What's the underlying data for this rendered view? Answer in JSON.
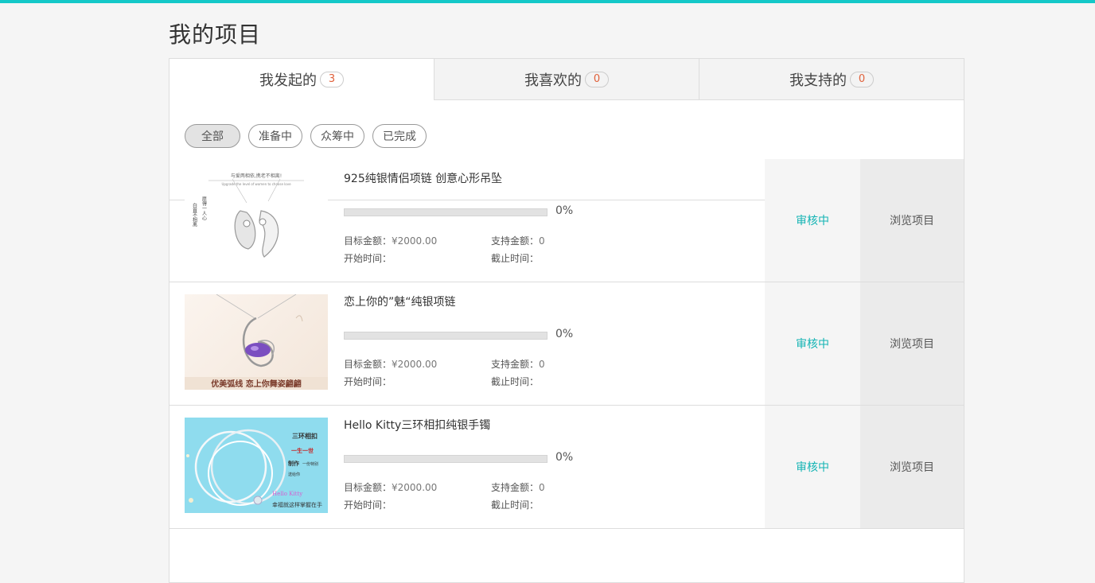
{
  "page_title": "我的项目",
  "tabs": [
    {
      "label": "我发起的",
      "count": "3"
    },
    {
      "label": "我喜欢的",
      "count": "0"
    },
    {
      "label": "我支持的",
      "count": "0"
    }
  ],
  "filters": [
    "全部",
    "准备中",
    "众筹中",
    "已完成"
  ],
  "labels": {
    "goal": "目标金额：",
    "support": "支持金额：",
    "start": "开始时间：",
    "end": "截止时间："
  },
  "projects": [
    {
      "title": "925纯银情侣项链 创意心形吊坠",
      "progress": 0,
      "progress_text": "0%",
      "goal": "¥2000.00",
      "support": "0",
      "start": "",
      "end": "",
      "status": "审核中",
      "action": "浏览项目"
    },
    {
      "title": "恋上你的”魅“纯银项链",
      "progress": 0,
      "progress_text": "0%",
      "goal": "¥2000.00",
      "support": "0",
      "start": "",
      "end": "",
      "status": "审核中",
      "action": "浏览项目"
    },
    {
      "title": "Hello Kitty三环相扣纯银手镯",
      "progress": 0,
      "progress_text": "0%",
      "goal": "¥2000.00",
      "support": "0",
      "start": "",
      "end": "",
      "status": "审核中",
      "action": "浏览项目"
    }
  ],
  "images": {
    "img1_text_top": "与爱两相依,携老不相离!",
    "img1_text_sub": "Upgrade the level of women to choose love",
    "img1_text_left1": "白首不相离",
    "img1_text_left2": "愿得一人心",
    "img2_caption": "优美弧线 恋上你舞姿翩翩",
    "img3_text1": "三环相扣",
    "img3_text2": "一生一世",
    "img3_text3": "制作",
    "img3_text4": "一份特别",
    "img3_text5": "送给你",
    "img3_text6": "Hello Kitty",
    "img3_text7": "幸福就这样掌握在手"
  },
  "colors": {
    "accent": "#14c8c8",
    "status": "#14b4b4",
    "badge": "#e0603a"
  }
}
